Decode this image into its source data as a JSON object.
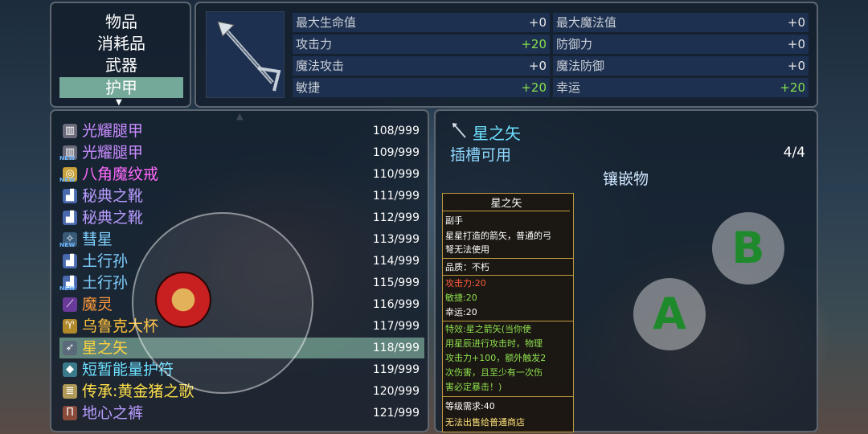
{
  "categories": [
    {
      "label": "物品",
      "selected": false
    },
    {
      "label": "消耗品",
      "selected": false
    },
    {
      "label": "武器",
      "selected": false
    },
    {
      "label": "护甲",
      "selected": true
    }
  ],
  "stats": [
    {
      "label": "最大生命值",
      "value": "+0"
    },
    {
      "label": "最大魔法值",
      "value": "+0"
    },
    {
      "label": "攻击力",
      "value": "+20"
    },
    {
      "label": "防御力",
      "value": "+0"
    },
    {
      "label": "魔法攻击",
      "value": "+0"
    },
    {
      "label": "魔法防御",
      "value": "+0"
    },
    {
      "label": "敏捷",
      "value": "+20"
    },
    {
      "label": "幸运",
      "value": "+20"
    }
  ],
  "items": [
    {
      "name": "光耀腿甲",
      "qty": "108/999",
      "color": "#c98cff",
      "icon": "leggings-icon",
      "isNew": false
    },
    {
      "name": "光耀腿甲",
      "qty": "109/999",
      "color": "#c98cff",
      "icon": "leggings-icon",
      "isNew": true
    },
    {
      "name": "八角魔纹戒",
      "qty": "110/999",
      "color": "#ff6aff",
      "icon": "ring-icon",
      "isNew": true
    },
    {
      "name": "秘典之靴",
      "qty": "111/999",
      "color": "#b89cff",
      "icon": "boots-icon",
      "isNew": false
    },
    {
      "name": "秘典之靴",
      "qty": "112/999",
      "color": "#b89cff",
      "icon": "boots-icon",
      "isNew": false
    },
    {
      "name": "彗星",
      "qty": "113/999",
      "color": "#7fd0ff",
      "icon": "comet-icon",
      "isNew": true
    },
    {
      "name": "土行孙",
      "qty": "114/999",
      "color": "#7fd0ff",
      "icon": "boots-icon",
      "isNew": false
    },
    {
      "name": "土行孙",
      "qty": "115/999",
      "color": "#7fd0ff",
      "icon": "boots-icon",
      "isNew": true
    },
    {
      "name": "魔灵",
      "qty": "116/999",
      "color": "#ff9a3c",
      "icon": "staff-icon",
      "isNew": false
    },
    {
      "name": "乌鲁克大杯",
      "qty": "117/999",
      "color": "#ffc23c",
      "icon": "cup-icon",
      "isNew": false
    },
    {
      "name": "星之矢",
      "qty": "118/999",
      "color": "#ffd23c",
      "icon": "arrow-icon",
      "isNew": false,
      "selected": true
    },
    {
      "name": "短暂能量护符",
      "qty": "119/999",
      "color": "#6de0ff",
      "icon": "amulet-icon",
      "isNew": false
    },
    {
      "name": "传承:黄金猪之歌",
      "qty": "120/999",
      "color": "#ffe04a",
      "icon": "scroll-icon",
      "isNew": false
    },
    {
      "name": "地心之裤",
      "qty": "121/999",
      "color": "#b89cff",
      "icon": "pants-icon",
      "isNew": false
    }
  ],
  "new_badge": "NEW",
  "detail": {
    "title": "星之矢",
    "slot_label": "插槽可用",
    "slot_count": "4/4",
    "socket_label": "镶嵌物"
  },
  "tooltip": {
    "title": "星之矢",
    "type": "副手",
    "desc": [
      "星星打造的箭矢，普通的弓",
      "弩无法使用"
    ],
    "quality": "品质：不朽",
    "bonus": [
      {
        "text": "攻击力:20",
        "color": "#ff5a3c"
      },
      {
        "text": "敏捷:20",
        "color": "#8ee04e"
      },
      {
        "text": "幸运:20",
        "color": "#ffffff"
      }
    ],
    "effect": [
      "特效:星之箭矢(当你使",
      "用星辰进行攻击时，物理",
      "攻击力+100，额外触发2",
      "次伤害，且至少有一次伤",
      "害必定暴击！)"
    ],
    "level_req": "等级需求:40",
    "shop_note": "无法出售给普通商店"
  },
  "buttons": {
    "a": "A",
    "b": "B"
  }
}
